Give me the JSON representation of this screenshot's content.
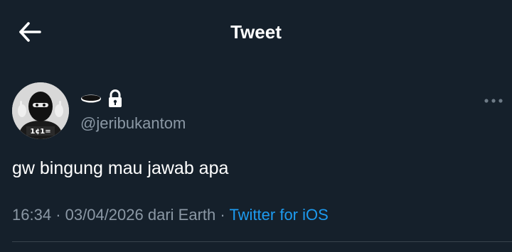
{
  "header": {
    "title": "Tweet",
    "back_icon": "arrow-left-icon"
  },
  "tweet": {
    "display_name_icon": "ellipse-glyph-icon",
    "protected_icon": "lock-icon",
    "handle": "@jeribukantom",
    "text": "gw bingung mau jawab apa",
    "time": "16:34",
    "date": "03/04/2026",
    "location_prefix": "dari",
    "location": "Earth",
    "separator": "·",
    "source": "Twitter for iOS",
    "more_icon": "more-horizontal-icon",
    "avatar_caption": "1¢1="
  },
  "colors": {
    "background": "#15202b",
    "text_primary": "#ffffff",
    "text_secondary": "#8b98a5",
    "link": "#1d9bf0",
    "divider": "#38444d"
  }
}
